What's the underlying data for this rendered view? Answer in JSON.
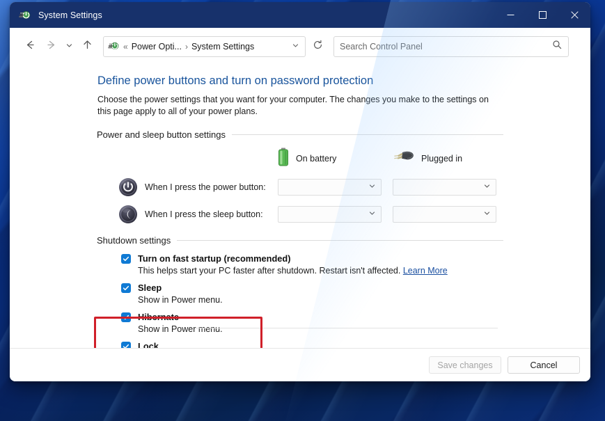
{
  "window": {
    "title": "System Settings",
    "title_icon": "power-options-icon",
    "controls": {
      "minimize": "minimize-icon",
      "maximize": "maximize-icon",
      "close": "close-icon"
    }
  },
  "toolbar": {
    "back": "back-arrow-icon",
    "forward": "forward-arrow-icon",
    "recent": "chevron-down-icon",
    "up": "up-arrow-icon",
    "refresh": "refresh-icon",
    "address_icon": "power-options-icon",
    "breadcrumbs": [
      {
        "label": "«",
        "separator": ""
      },
      {
        "label": "Power Opti...",
        "separator": "›"
      },
      {
        "label": "System Settings",
        "separator": ""
      }
    ],
    "address_chevron": "chevron-down-icon",
    "search": {
      "placeholder": "Search Control Panel",
      "value": "",
      "icon": "search-icon"
    }
  },
  "page": {
    "title": "Define power buttons and turn on password protection",
    "description": "Choose the power settings that you want for your computer. The changes you make to the settings on this page apply to all of your power plans."
  },
  "power_section": {
    "heading": "Power and sleep button settings",
    "columns": [
      {
        "label": "On battery",
        "icon": "battery-icon"
      },
      {
        "label": "Plugged in",
        "icon": "power-plug-icon"
      }
    ],
    "rows": [
      {
        "icon": "power-button-icon",
        "label": "When I press the power button:",
        "on_battery": "",
        "plugged_in": ""
      },
      {
        "icon": "sleep-button-icon",
        "label": "When I press the sleep button:",
        "on_battery": "",
        "plugged_in": ""
      }
    ]
  },
  "shutdown_section": {
    "heading": "Shutdown settings",
    "items": [
      {
        "title": "Turn on fast startup (recommended)",
        "subtitle": "This helps start your PC faster after shutdown. Restart isn't affected.",
        "link": "Learn More",
        "checked": true
      },
      {
        "title": "Sleep",
        "subtitle": "Show in Power menu.",
        "link": "",
        "checked": true
      },
      {
        "title": "Hibernate",
        "subtitle": "Show in Power menu.",
        "link": "",
        "checked": true,
        "highlighted": true
      },
      {
        "title": "Lock",
        "subtitle": "",
        "link": "",
        "checked": true
      }
    ]
  },
  "footer": {
    "save_label": "Save changes",
    "save_enabled": false,
    "cancel_label": "Cancel"
  },
  "colors": {
    "titlebar": "#17316b",
    "link": "#1a4fa0",
    "page_title": "#19549c",
    "checkbox": "#0f7ad4",
    "annotation": "#d0202a"
  }
}
